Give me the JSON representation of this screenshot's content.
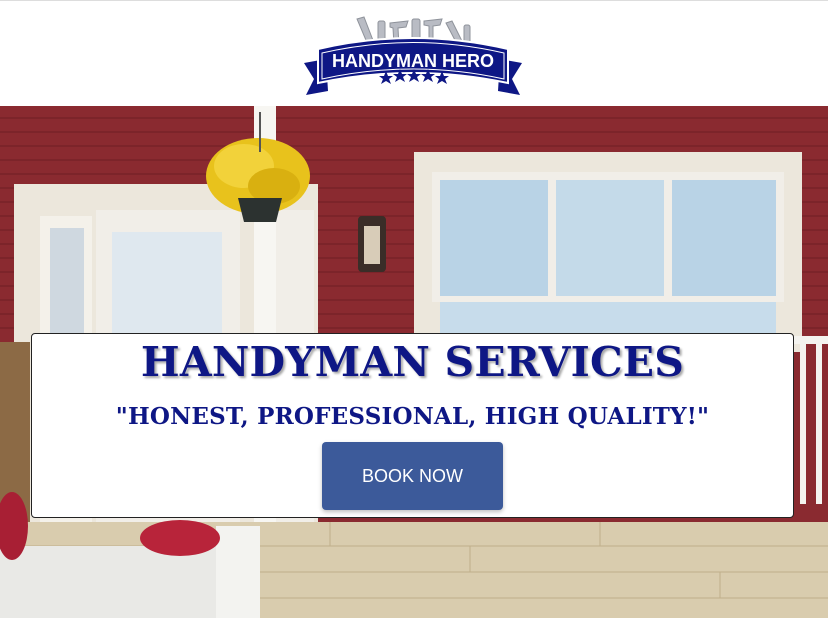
{
  "brand": {
    "logo_text": "HANDYMAN HERO",
    "primary_color": "#0e1785",
    "banner_color": "#0e1785"
  },
  "hero": {
    "title": "HANDYMAN SERVICES",
    "tagline": "\"HONEST, PROFESSIONAL, HIGH QUALITY!\"",
    "cta_label": "BOOK NOW",
    "cta_color": "#3c5a9a",
    "background_wall_color": "#8a2a30"
  }
}
